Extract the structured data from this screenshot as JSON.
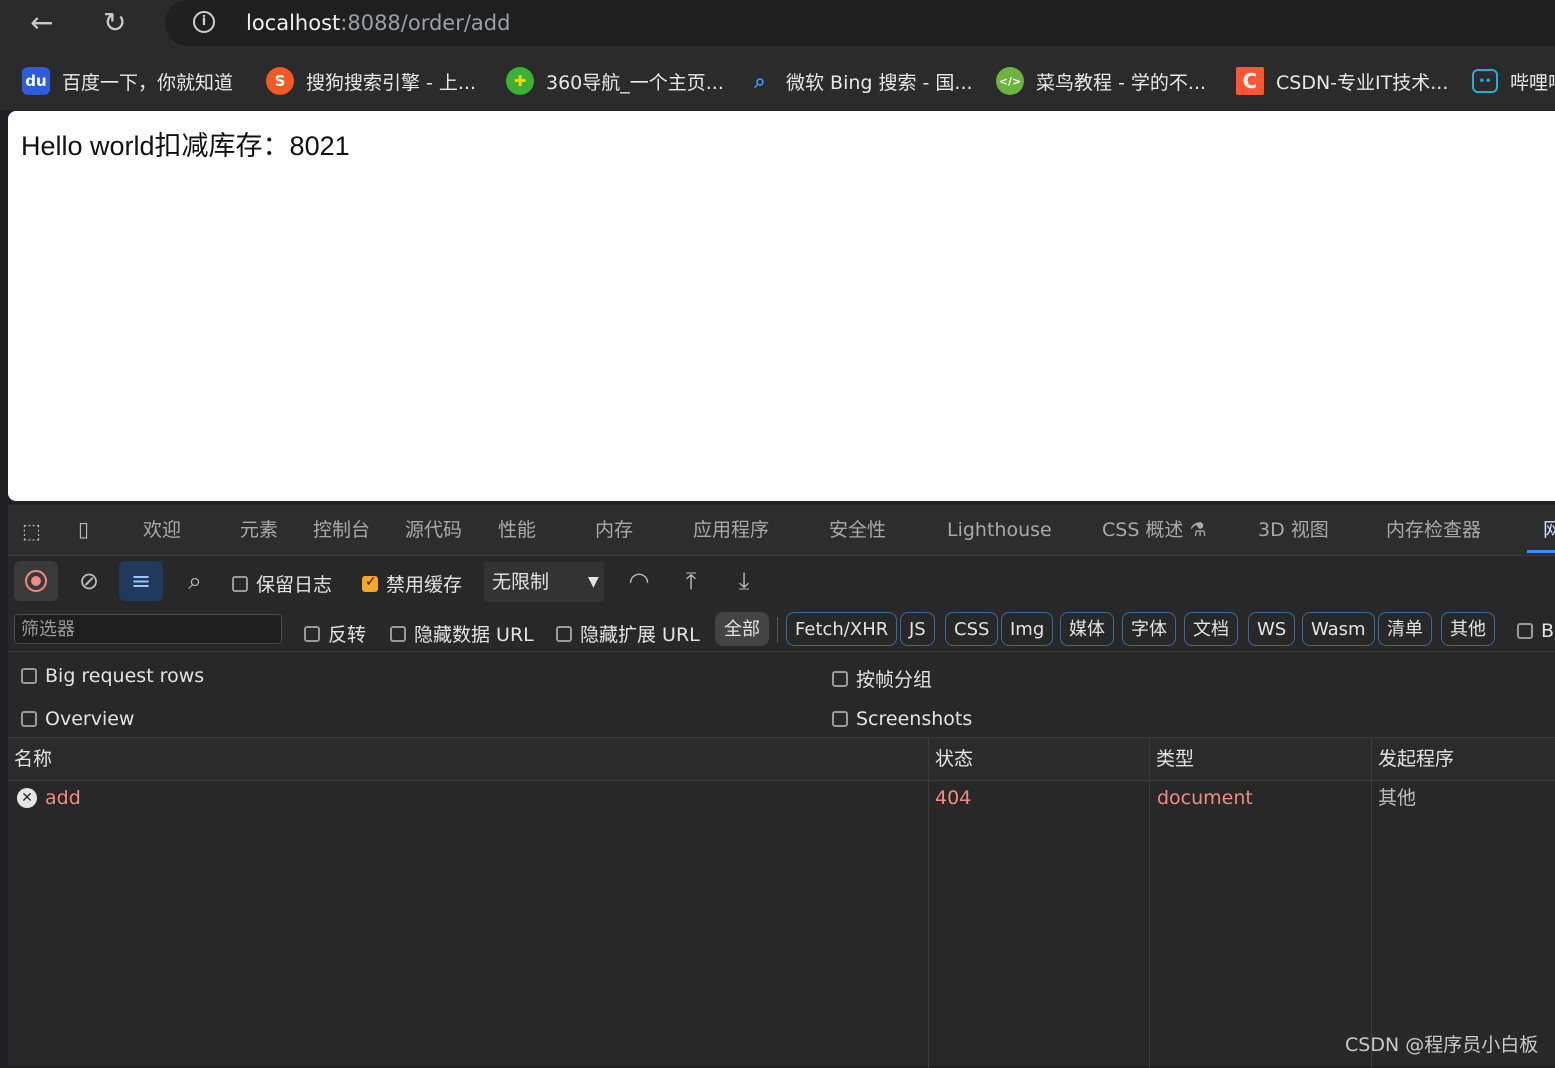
{
  "address_bar": {
    "host": "localhost",
    "path": ":8088/order/add"
  },
  "bookmarks": [
    {
      "label": "百度一下，你就知道",
      "icon": "baidu-icon",
      "color": "#2d5ddc"
    },
    {
      "label": "搜狗搜索引擎 - 上...",
      "icon": "sogou-icon",
      "color": "#f15a24"
    },
    {
      "label": "360导航_一个主页...",
      "icon": "360-icon",
      "color": "#3cb034"
    },
    {
      "label": "微软 Bing 搜索 - 国...",
      "icon": "bing-search-icon",
      "color": "#3b8cff"
    },
    {
      "label": "菜鸟教程 - 学的不...",
      "icon": "runoob-icon",
      "color": "#6cb33f"
    },
    {
      "label": "CSDN-专业IT技术...",
      "icon": "csdn-icon",
      "color": "#fc5531"
    },
    {
      "label": "哔哩哔",
      "icon": "bilibili-icon",
      "color": "#23ade5"
    }
  ],
  "page": {
    "text": "Hello world扣减库存：8021"
  },
  "devtools": {
    "tabs": [
      "欢迎",
      "元素",
      "控制台",
      "源代码",
      "性能",
      "内存",
      "应用程序",
      "安全性",
      "Lighthouse",
      "CSS 概述 ⚗",
      "3D 视图",
      "内存检查器",
      "网"
    ],
    "toolbar": {
      "preserve_log": "保留日志",
      "disable_cache": "禁用缓存",
      "throttle": "无限制"
    },
    "filter": {
      "placeholder": "筛选器",
      "invert": "反转",
      "hide_data_url": "隐藏数据 URL",
      "hide_ext_url": "隐藏扩展 URL",
      "all": "全部",
      "chips": [
        "Fetch/XHR",
        "JS",
        "CSS",
        "Img",
        "媒体",
        "字体",
        "文档",
        "WS",
        "Wasm",
        "清单",
        "其他"
      ],
      "trailing": "B"
    },
    "options": {
      "big_rows": "Big request rows",
      "group_by_frame": "按帧分组",
      "overview": "Overview",
      "screenshots": "Screenshots"
    },
    "table": {
      "headers": [
        "名称",
        "状态",
        "类型",
        "发起程序"
      ],
      "rows": [
        {
          "name": "add",
          "status": "404",
          "type": "document",
          "initiator": "其他"
        }
      ]
    }
  },
  "watermark": "CSDN @程序员小白板"
}
